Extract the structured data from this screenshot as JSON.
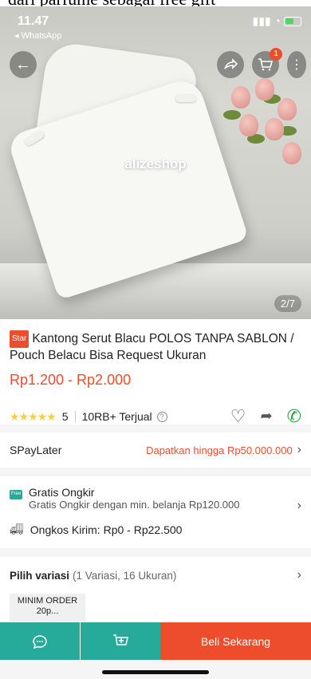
{
  "crop_text": "dari parfume sebagai free gift",
  "status_bar": {
    "time": "11.47",
    "back_app": "◂ WhatsApp",
    "signal": "▐░▒"
  },
  "hero": {
    "watermark": "alizeshop",
    "page_indicator": "2/7",
    "cart_count": "1"
  },
  "icons": {
    "back": "arrow-left",
    "share": "share",
    "cart": "cart",
    "more": "more-vertical"
  },
  "product": {
    "badge": "Star",
    "title": "Kantong Serut Blacu POLOS TANPA SABLON / Pouch Belacu Bisa Request Ukuran",
    "price": "Rp1.200 - Rp2.000",
    "stars": "★★★★★",
    "rating": "5",
    "sold": "10RB+ Terjual"
  },
  "spaylater": {
    "label": "SPayLater",
    "promo": "Dapatkan hingga Rp50.000.000"
  },
  "shipping": {
    "title": "Gratis Ongkir",
    "subtitle": "Gratis Ongkir dengan min. belanja Rp120.000",
    "cost": "Ongkos Kirim: Rp0 - Rp22.500"
  },
  "variation": {
    "label": "Pilih variasi",
    "count": "(1 Variasi, 16 Ukuran)",
    "chip": "MINIM ORDER 20p..."
  },
  "bottom_bar": {
    "buy_label": "Beli Sekarang"
  },
  "colors": {
    "accent": "#ee4d2d",
    "teal": "#26aa99",
    "star": "#ffce3d"
  }
}
